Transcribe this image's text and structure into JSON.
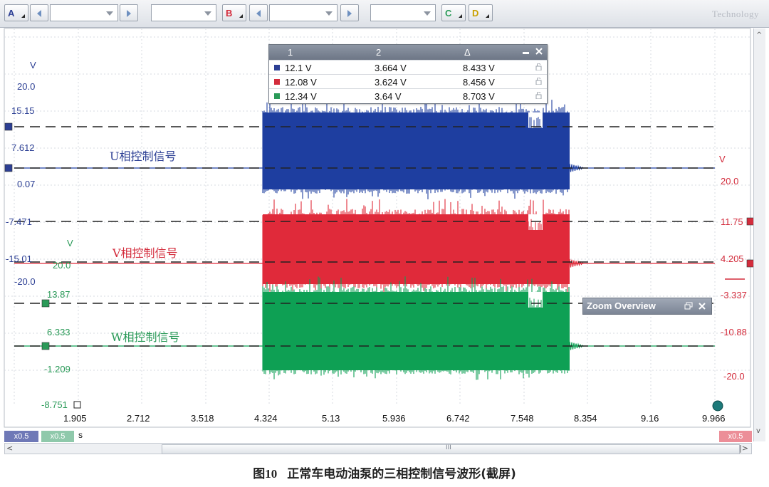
{
  "toolbar": {
    "channels": [
      {
        "letter": "A",
        "color": "#2c3f94"
      },
      {
        "letter": "B",
        "color": "#d32c3c"
      },
      {
        "letter": "C",
        "color": "#2a9a58"
      },
      {
        "letter": "D",
        "color": "#c9a000"
      }
    ],
    "logo_text": "Technology"
  },
  "axis_units": {
    "left_blue_unit": "V",
    "right_red_unit": "V",
    "left_green_unit": "V",
    "x_unit": "s"
  },
  "left_blue_ticks": [
    "20.0",
    "15.15",
    "7.612",
    "0.07",
    "-7.471",
    "-15.01",
    "-20.0"
  ],
  "left_green_ticks": [
    "20.0",
    "13.87",
    "6.333",
    "-1.209",
    "-8.751"
  ],
  "right_red_ticks": [
    "20.0",
    "11.75",
    "4.205",
    "-3.337",
    "-10.88",
    "-20.0"
  ],
  "x_ticks": [
    "1.905",
    "2.712",
    "3.518",
    "4.324",
    "5.13",
    "5.936",
    "6.742",
    "7.548",
    "8.354",
    "9.16",
    "9.966"
  ],
  "channel_labels": {
    "u": "U相控制信号",
    "v": "V相控制信号",
    "w": "W相控制信号"
  },
  "measurements": {
    "headers": [
      "1",
      "2",
      "Δ"
    ],
    "rows": [
      {
        "color": "#2c3f94",
        "c1": "12.1 V",
        "c2": "3.664 V",
        "delta": "8.433 V"
      },
      {
        "color": "#d32c3c",
        "c1": "12.08 V",
        "c2": "3.624 V",
        "delta": "8.456 V"
      },
      {
        "color": "#2a9a58",
        "c1": "12.34 V",
        "c2": "3.64 V",
        "delta": "8.703 V"
      }
    ]
  },
  "zoom_overview": {
    "title": "Zoom Overview"
  },
  "scale_tags": {
    "blue": "x0.5",
    "green": "x0.5",
    "red": "x0.5"
  },
  "scroll": {
    "thumb_glyph": "III"
  },
  "caption": {
    "figure_no": "图10",
    "text": "正常车电动油泵的三相控制信号波形(截屏)"
  },
  "colors": {
    "blue": "#1f3fa0",
    "red": "#e02a3a",
    "green": "#0fa055"
  }
}
